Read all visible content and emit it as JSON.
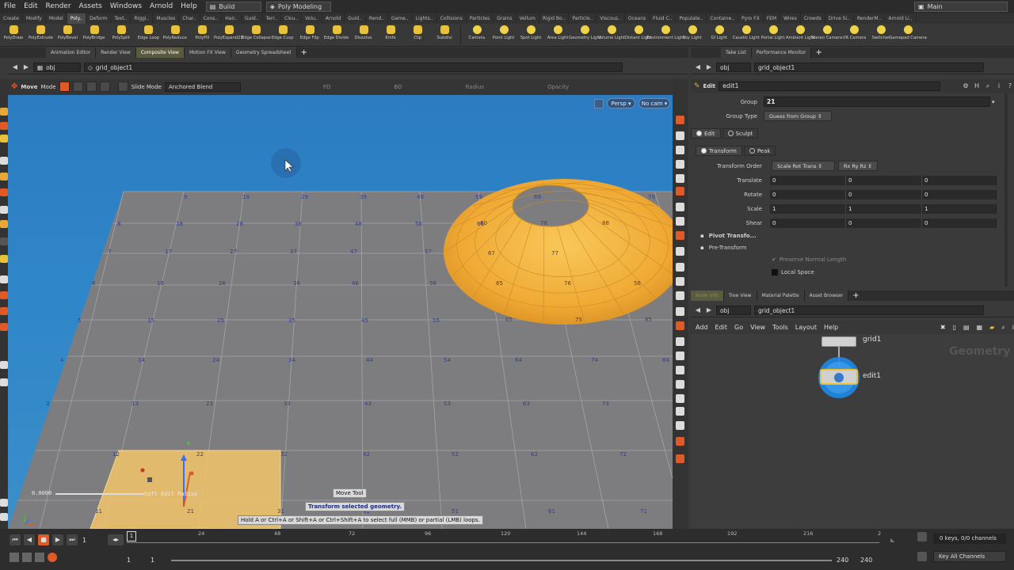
{
  "menubar": {
    "items": [
      "File",
      "Edit",
      "Render",
      "Assets",
      "Windows",
      "Arnold",
      "Help"
    ],
    "desktop": "Build",
    "shelf_set": "Poly Modeling",
    "workspace": "Main"
  },
  "shelf_tabs": [
    "Create",
    "Modify",
    "Model",
    "Poly..",
    "Deform",
    "Text..",
    "Riggi..",
    "Muscles",
    "Char..",
    "Cons..",
    "Hair..",
    "Guid..",
    "Terr..",
    "Clou..",
    "Volu..",
    "Arnold",
    "Guid..",
    "Rend..",
    "Game..",
    "Lights..",
    "Collisions",
    "Particles",
    "Grains",
    "Vellum",
    "Rigid Bo..",
    "Particle..",
    "Viscous..",
    "Oceans",
    "Fluid C..",
    "Populate..",
    "Containe..",
    "Pyro FX",
    "FEM",
    "Wires",
    "Crowds",
    "Drive Si..",
    "RenderM..",
    "Arnold Li.."
  ],
  "shelf_tools_left": [
    "PolyDraw",
    "PolyExtrude",
    "PolyBevel",
    "PolyBridge",
    "PolySplit",
    "Edge Loop",
    "PolyReduce",
    "PolyFill",
    "PolyExpand2D",
    "Edge Collapse",
    "Edge Cusp",
    "Edge Flip",
    "Edge Divide",
    "Dissolve",
    "Knife",
    "Clip",
    "Subdivi"
  ],
  "shelf_tools_right": [
    "Camera",
    "Point Light",
    "Spot Light",
    "Area Light",
    "Geometry Light",
    "Volume Light",
    "Distant Light",
    "Environment Light",
    "Sky Light",
    "GI Light",
    "Caustic Light",
    "Portal Light",
    "Ambient Light",
    "Stereo Camera",
    "VR Camera",
    "Switcher",
    "Gamepad Camera"
  ],
  "left_pane_tabs": [
    "Animation Editor",
    "Render View",
    "Composite View",
    "Motion FX View",
    "Geometry Spreadsheet"
  ],
  "right_top_tabs": [
    "Take List",
    "Performance Monitor"
  ],
  "right_bottom_tabs": [
    "Node Info",
    "Tree View",
    "Material Palette",
    "Asset Browser"
  ],
  "path_left": {
    "context": "obj",
    "node": "grid_object1"
  },
  "path_right_top": {
    "context": "obj",
    "node": "grid_object1"
  },
  "path_right_bottom": {
    "context": "obj",
    "node": "grid_object1"
  },
  "viewport_toolbar": {
    "tool": "Move",
    "mode_label": "Mode",
    "slide_mode": "Slide Mode",
    "blend": "Anchored Blend",
    "fields": [
      "FD",
      "BD",
      "Radius",
      "Opacity"
    ]
  },
  "viewport": {
    "camera_menu": "Persp",
    "cam_menu": "No cam",
    "soft_edit_value": "0.0000",
    "soft_edit_label": "Soft Edit Radius",
    "tooltip_title": "Move Tool",
    "tooltip_desc": "Transform selected geometry.",
    "tooltip_hint": "Hold A or Ctrl+A or Shift+A or Ctrl+Shift+A to select full (MMB) or partial (LMB) loops.",
    "grid_point_labels": [
      "9",
      "19",
      "29",
      "39",
      "49",
      "59",
      "69",
      "79",
      "8",
      "18",
      "28",
      "38",
      "48",
      "58",
      "68",
      "7",
      "17",
      "27",
      "37",
      "47",
      "57",
      "6",
      "16",
      "26",
      "36",
      "46",
      "56",
      "5",
      "15",
      "25",
      "35",
      "45",
      "55",
      "4",
      "14",
      "24",
      "34",
      "44",
      "54",
      "64",
      "74",
      "84",
      "3",
      "13",
      "23",
      "33",
      "43",
      "53",
      "63",
      "73",
      "12",
      "22",
      "32",
      "42",
      "52",
      "62",
      "72",
      "11",
      "21",
      "31",
      "41",
      "51",
      "61",
      "71"
    ],
    "torus_point_labels": [
      "60",
      "78",
      "88",
      "67",
      "77",
      "56",
      "65",
      "76",
      "65",
      "75",
      "85"
    ]
  },
  "params": {
    "node_type": "Edit",
    "node_name": "edit1",
    "group_label": "Group",
    "group_value": "21",
    "group_type_label": "Group Type",
    "group_type_value": "Guess from Group",
    "mode_tabs": [
      "Edit",
      "Sculpt"
    ],
    "xform_tabs": [
      "Transform",
      "Peak"
    ],
    "transform_order_label": "Transform Order",
    "transform_order_value": "Scale Rot Trans",
    "rot_order_value": "Rx Ry Rz",
    "rows": [
      {
        "label": "Translate",
        "values": [
          "0",
          "0",
          "0"
        ]
      },
      {
        "label": "Rotate",
        "values": [
          "0",
          "0",
          "0"
        ]
      },
      {
        "label": "Scale",
        "values": [
          "1",
          "1",
          "1"
        ]
      },
      {
        "label": "Shear",
        "values": [
          "0",
          "0",
          "0"
        ]
      }
    ],
    "sections": [
      "Pivot Transfo...",
      "Pre-Transform"
    ],
    "preserve_label": "Preserve Normal Length",
    "local_space_label": "Local Space"
  },
  "network": {
    "menu": [
      "Add",
      "Edit",
      "Go",
      "View",
      "Tools",
      "Layout",
      "Help"
    ],
    "watermark": "Geometry",
    "nodes": [
      {
        "name": "grid1"
      },
      {
        "name": "edit1"
      }
    ]
  },
  "timeline": {
    "frame_current": "1",
    "ticks": [
      "24",
      "48",
      "72",
      "96",
      "120",
      "144",
      "168",
      "192",
      "216",
      "2"
    ],
    "start": "1",
    "start2": "1",
    "end": "240",
    "end2": "240",
    "keys_info": "0 keys, 0/0 channels",
    "key_all": "Key All Channels"
  },
  "colors": {
    "viewport_sky": "#2f86c8",
    "grid_fill": "#7d7d7f",
    "torus": "#f0b23e",
    "accent_orange": "#e05a28",
    "selection": "#f2c46a"
  }
}
